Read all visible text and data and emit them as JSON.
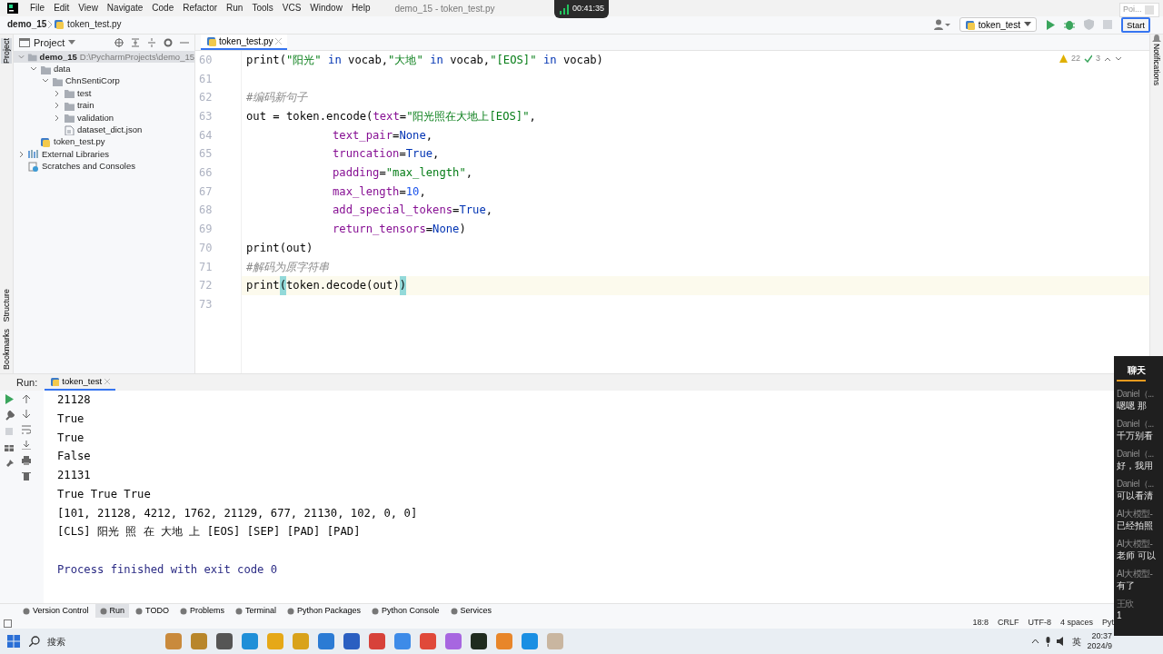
{
  "menu_bar": {
    "items": [
      "File",
      "Edit",
      "View",
      "Navigate",
      "Code",
      "Refactor",
      "Run",
      "Tools",
      "VCS",
      "Window",
      "Help"
    ],
    "window_title": "demo_15 - token_test.py"
  },
  "recorder": {
    "time": "00:41:35"
  },
  "breadcrumb": [
    "demo_15",
    "token_test.py"
  ],
  "toolbar": {
    "run_config": "token_test",
    "start_button": "Start",
    "popup_label": "Poi..."
  },
  "left_strip": [
    {
      "label": "Project",
      "selected": true
    },
    {
      "label": "Structure",
      "selected": false
    },
    {
      "label": "Bookmarks",
      "selected": false
    }
  ],
  "project_panel": {
    "title": "Project",
    "tree": [
      {
        "label": "demo_15",
        "path": "D:\\PycharmProjects\\demo_15",
        "kind": "folder",
        "expanded": true,
        "selected": true,
        "children": [
          {
            "label": "data",
            "kind": "folder",
            "expanded": true,
            "selected": false,
            "children": [
              {
                "label": "ChnSentiCorp",
                "kind": "folder",
                "expanded": true,
                "selected": false,
                "children": [
                  {
                    "label": "test",
                    "kind": "folder",
                    "expanded": false,
                    "selected": false
                  },
                  {
                    "label": "train",
                    "kind": "folder",
                    "expanded": false,
                    "selected": false
                  },
                  {
                    "label": "validation",
                    "kind": "folder",
                    "expanded": false,
                    "selected": false
                  },
                  {
                    "label": "dataset_dict.json",
                    "kind": "json",
                    "selected": false
                  }
                ]
              }
            ]
          },
          {
            "label": "token_test.py",
            "kind": "python",
            "selected": false
          }
        ]
      },
      {
        "label": "External Libraries",
        "kind": "library",
        "expanded": false,
        "selected": false
      },
      {
        "label": "Scratches and Consoles",
        "kind": "scratches",
        "selected": false
      }
    ]
  },
  "editor": {
    "tabs": [
      {
        "label": "token_test.py",
        "selected": true
      }
    ],
    "inspections": {
      "warnings": "22",
      "ok": "3"
    },
    "lines": [
      {
        "number": "60",
        "kind": "code",
        "current": false,
        "segments": [
          {
            "text": "print(",
            "kind": "plain"
          },
          {
            "text": "\"阳光\"",
            "kind": "str"
          },
          {
            "text": " in ",
            "kind": "kw"
          },
          {
            "text": "vocab,",
            "kind": "plain"
          },
          {
            "text": "\"大地\"",
            "kind": "str"
          },
          {
            "text": " in ",
            "kind": "kw"
          },
          {
            "text": "vocab,",
            "kind": "plain"
          },
          {
            "text": "\"[EOS]\"",
            "kind": "str"
          },
          {
            "text": " in ",
            "kind": "kw"
          },
          {
            "text": "vocab)",
            "kind": "plain"
          }
        ]
      },
      {
        "number": "61",
        "kind": "blank"
      },
      {
        "number": "62",
        "kind": "code",
        "current": false,
        "segments": [
          {
            "text": "#编码新句子",
            "kind": "comment"
          }
        ]
      },
      {
        "number": "63",
        "kind": "code",
        "current": false,
        "segments": [
          {
            "text": "out = token.encode(",
            "kind": "plain"
          },
          {
            "text": "text",
            "kind": "param"
          },
          {
            "text": "=",
            "kind": "plain"
          },
          {
            "text": "\"阳光照在大地上[EOS]\"",
            "kind": "str"
          },
          {
            "text": ",",
            "kind": "plain"
          }
        ]
      },
      {
        "number": "64",
        "kind": "continuation",
        "current": false,
        "segments": [
          {
            "text": "text_pair",
            "kind": "param"
          },
          {
            "text": "=",
            "kind": "plain"
          },
          {
            "text": "None",
            "kind": "kw"
          },
          {
            "text": ",",
            "kind": "plain"
          }
        ]
      },
      {
        "number": "65",
        "kind": "continuation",
        "current": false,
        "segments": [
          {
            "text": "truncation",
            "kind": "param"
          },
          {
            "text": "=",
            "kind": "plain"
          },
          {
            "text": "True",
            "kind": "kw"
          },
          {
            "text": ",",
            "kind": "plain"
          }
        ]
      },
      {
        "number": "66",
        "kind": "continuation",
        "current": false,
        "segments": [
          {
            "text": "padding",
            "kind": "param"
          },
          {
            "text": "=",
            "kind": "plain"
          },
          {
            "text": "\"max_length\"",
            "kind": "str"
          },
          {
            "text": ",",
            "kind": "plain"
          }
        ]
      },
      {
        "number": "67",
        "kind": "continuation",
        "current": false,
        "segments": [
          {
            "text": "max_length",
            "kind": "param"
          },
          {
            "text": "=",
            "kind": "plain"
          },
          {
            "text": "10",
            "kind": "num"
          },
          {
            "text": ",",
            "kind": "plain"
          }
        ]
      },
      {
        "number": "68",
        "kind": "continuation",
        "current": false,
        "segments": [
          {
            "text": "add_special_tokens",
            "kind": "param"
          },
          {
            "text": "=",
            "kind": "plain"
          },
          {
            "text": "True",
            "kind": "kw"
          },
          {
            "text": ",",
            "kind": "plain"
          }
        ]
      },
      {
        "number": "69",
        "kind": "continuation",
        "current": false,
        "segments": [
          {
            "text": "return_tensors",
            "kind": "param"
          },
          {
            "text": "=",
            "kind": "plain"
          },
          {
            "text": "None",
            "kind": "kw"
          },
          {
            "text": ")",
            "kind": "plain"
          }
        ]
      },
      {
        "number": "70",
        "kind": "code",
        "current": false,
        "segments": [
          {
            "text": "print(out)",
            "kind": "plain"
          }
        ]
      },
      {
        "number": "71",
        "kind": "code",
        "current": false,
        "segments": [
          {
            "text": "#解码为原字符串",
            "kind": "comment"
          }
        ]
      },
      {
        "number": "72",
        "kind": "code",
        "current": true,
        "segments": [
          {
            "text": "print",
            "kind": "plain"
          },
          {
            "text": "(",
            "kind": "brace"
          },
          {
            "text": "token.decode(out)",
            "kind": "plain"
          },
          {
            "text": ")",
            "kind": "brace"
          }
        ]
      },
      {
        "number": "73",
        "kind": "blank"
      }
    ]
  },
  "right_strip": {
    "label": "Notifications"
  },
  "run_panel": {
    "label": "Run:",
    "tabs": [
      {
        "label": "token_test",
        "selected": true
      }
    ],
    "output": [
      {
        "kind": "stdout",
        "text": "21128"
      },
      {
        "kind": "stdout",
        "text": "True"
      },
      {
        "kind": "stdout",
        "text": "True"
      },
      {
        "kind": "stdout",
        "text": "False"
      },
      {
        "kind": "stdout",
        "text": "21131"
      },
      {
        "kind": "stdout",
        "text": "True True True"
      },
      {
        "kind": "stdout",
        "text": "[101, 21128, 4212, 1762, 21129, 677, 21130, 102, 0, 0]"
      },
      {
        "kind": "stdout",
        "text": "[CLS] 阳光 照 在 大地 上 [EOS] [SEP] [PAD] [PAD]"
      },
      {
        "kind": "blank"
      },
      {
        "kind": "exit",
        "text": "Process finished with exit code 0"
      }
    ]
  },
  "tool_tabs": [
    {
      "label": "Version Control",
      "selected": false
    },
    {
      "label": "Run",
      "selected": true
    },
    {
      "label": "TODO",
      "selected": false
    },
    {
      "label": "Problems",
      "selected": false
    },
    {
      "label": "Terminal",
      "selected": false
    },
    {
      "label": "Python Packages",
      "selected": false
    },
    {
      "label": "Python Console",
      "selected": false
    },
    {
      "label": "Services",
      "selected": false
    }
  ],
  "status_bar": {
    "items": [
      "18:8",
      "CRLF",
      "UTF-8",
      "4 spaces",
      "Pyt"
    ]
  },
  "taskbar": {
    "search": "搜索",
    "input_method": "英",
    "time": "20:37",
    "date": "2024/9"
  },
  "chat": {
    "title": "聊天",
    "messages": [
      {
        "sender": "Daniel（...",
        "text": "嗯嗯 那"
      },
      {
        "sender": "Daniel（...",
        "text": "千万别看"
      },
      {
        "sender": "Daniel（...",
        "text": "好，我用"
      },
      {
        "sender": "Daniel（...",
        "text": "可以看清"
      },
      {
        "sender": "AI大模型-",
        "text": "已经拍照"
      },
      {
        "sender": "AI大模型-",
        "text": "老师 可以"
      },
      {
        "sender": "AI大模型-",
        "text": "有了"
      },
      {
        "sender": "王欣",
        "text": "1"
      }
    ]
  }
}
